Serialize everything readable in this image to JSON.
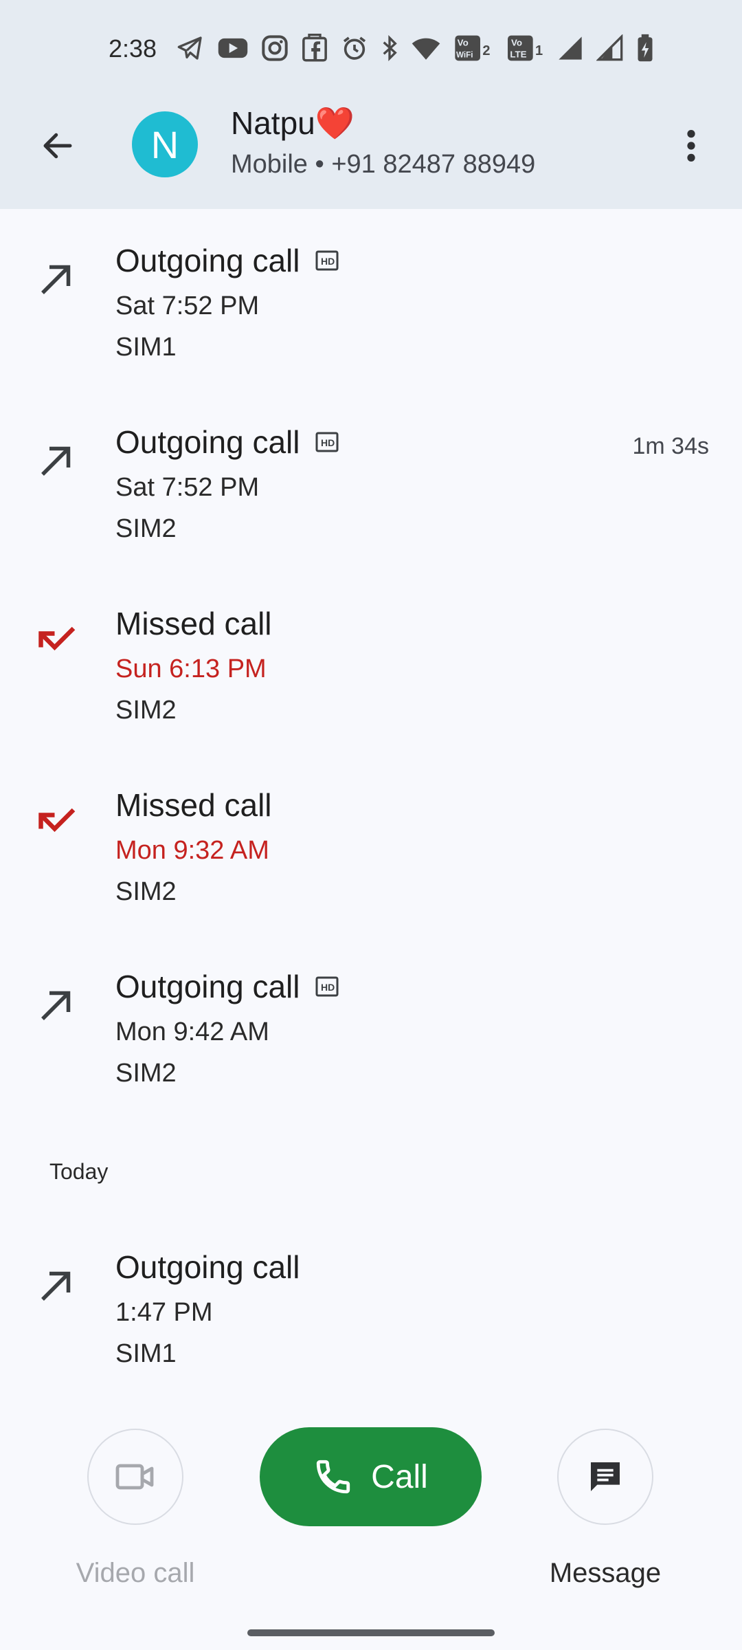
{
  "status_bar": {
    "time": "2:38",
    "icons": [
      "telegram-icon",
      "youtube-icon",
      "instagram-icon",
      "facebook-shop-icon",
      "alarm-icon",
      "bluetooth-icon",
      "wifi-icon",
      "vowifi2-icon",
      "volte1-icon",
      "signal1-icon",
      "signal2-icon",
      "battery-charging-icon"
    ],
    "vowifi_text": "Vo WiFi 2",
    "volte_text": "Vo LTE 1"
  },
  "header": {
    "back_icon": "arrow-back-icon",
    "avatar_letter": "N",
    "avatar_color": "#1fbcd2",
    "contact_name": "Natpu❤️",
    "contact_subtitle": "Mobile • +91 82487 88949",
    "overflow_icon": "more-vert-icon"
  },
  "calls": [
    {
      "type": "Outgoing call",
      "direction": "outgoing",
      "hd": true,
      "time": "Sat 7:52 PM",
      "sim": "SIM1",
      "duration": ""
    },
    {
      "type": "Outgoing call",
      "direction": "outgoing",
      "hd": true,
      "time": "Sat 7:52 PM",
      "sim": "SIM2",
      "duration": "1m 34s"
    },
    {
      "type": "Missed call",
      "direction": "missed",
      "hd": false,
      "time": "Sun 6:13 PM",
      "sim": "SIM2",
      "duration": ""
    },
    {
      "type": "Missed call",
      "direction": "missed",
      "hd": false,
      "time": "Mon 9:32 AM",
      "sim": "SIM2",
      "duration": ""
    },
    {
      "type": "Outgoing call",
      "direction": "outgoing",
      "hd": true,
      "time": "Mon 9:42 AM",
      "sim": "SIM2",
      "duration": ""
    },
    {
      "type": "Outgoing call",
      "direction": "outgoing",
      "hd": false,
      "time": "1:47 PM",
      "sim": "SIM1",
      "duration": ""
    }
  ],
  "section_today": "Today",
  "actions": {
    "video_label": "Video call",
    "call_label": "Call",
    "message_label": "Message"
  },
  "colors": {
    "header_bg": "#e5ebf2",
    "missed": "#c5221f",
    "call_button": "#1e8e3e"
  }
}
